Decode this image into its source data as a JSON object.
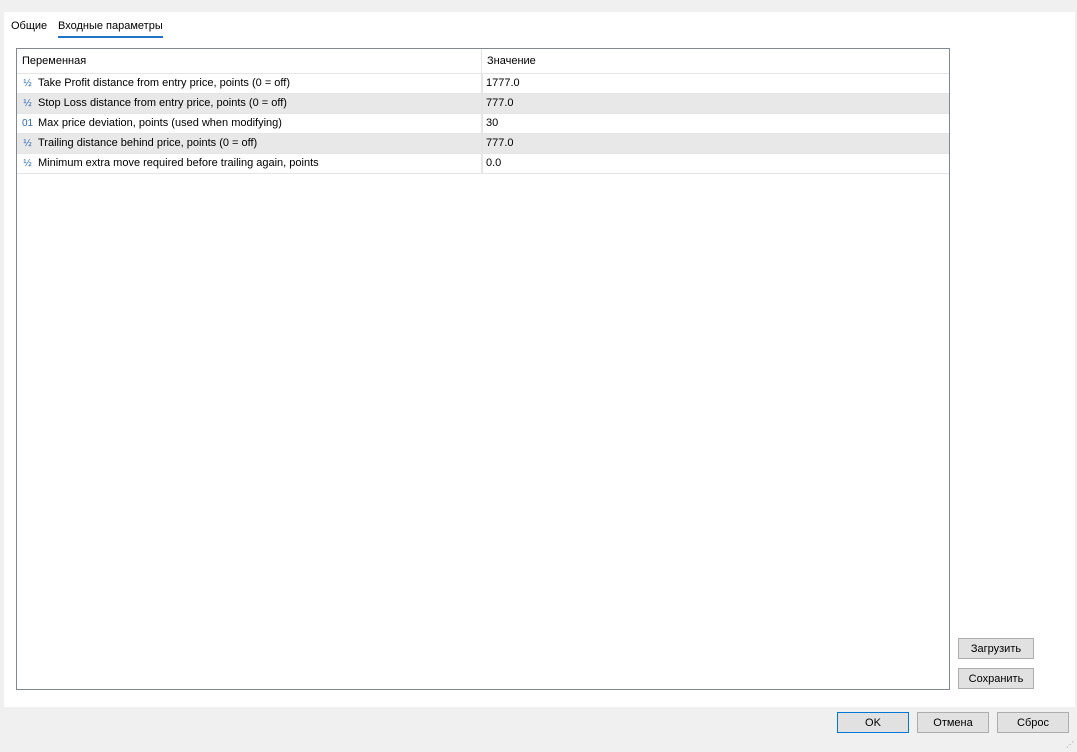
{
  "tabs": [
    {
      "label": "Общие",
      "active": false
    },
    {
      "label": "Входные параметры",
      "active": true
    }
  ],
  "grid": {
    "columns": [
      "Переменная",
      "Значение"
    ],
    "rows": [
      {
        "icon": "fraction-icon",
        "icon_glyph": "½",
        "name": "Take Profit distance from entry price, points (0 = off)",
        "value": "1777.0"
      },
      {
        "icon": "fraction-icon",
        "icon_glyph": "½",
        "name": "Stop Loss distance from entry price, points (0 = off)",
        "value": "777.0"
      },
      {
        "icon": "integer-icon",
        "icon_glyph": "01",
        "name": "Max price deviation, points (used when modifying)",
        "value": "30"
      },
      {
        "icon": "fraction-icon",
        "icon_glyph": "½",
        "name": "Trailing distance behind price, points (0 = off)",
        "value": "777.0"
      },
      {
        "icon": "fraction-icon",
        "icon_glyph": "½",
        "name": "Minimum extra move required before trailing again, points",
        "value": "0.0"
      }
    ]
  },
  "side_buttons": {
    "load": "Загрузить",
    "save": "Сохранить"
  },
  "footer": {
    "ok": "OK",
    "cancel": "Отмена",
    "reset": "Сброс"
  },
  "colors": {
    "accent": "#1e73c8",
    "icon": "#2d6bb5",
    "alt_row": "#e8e8e8"
  }
}
